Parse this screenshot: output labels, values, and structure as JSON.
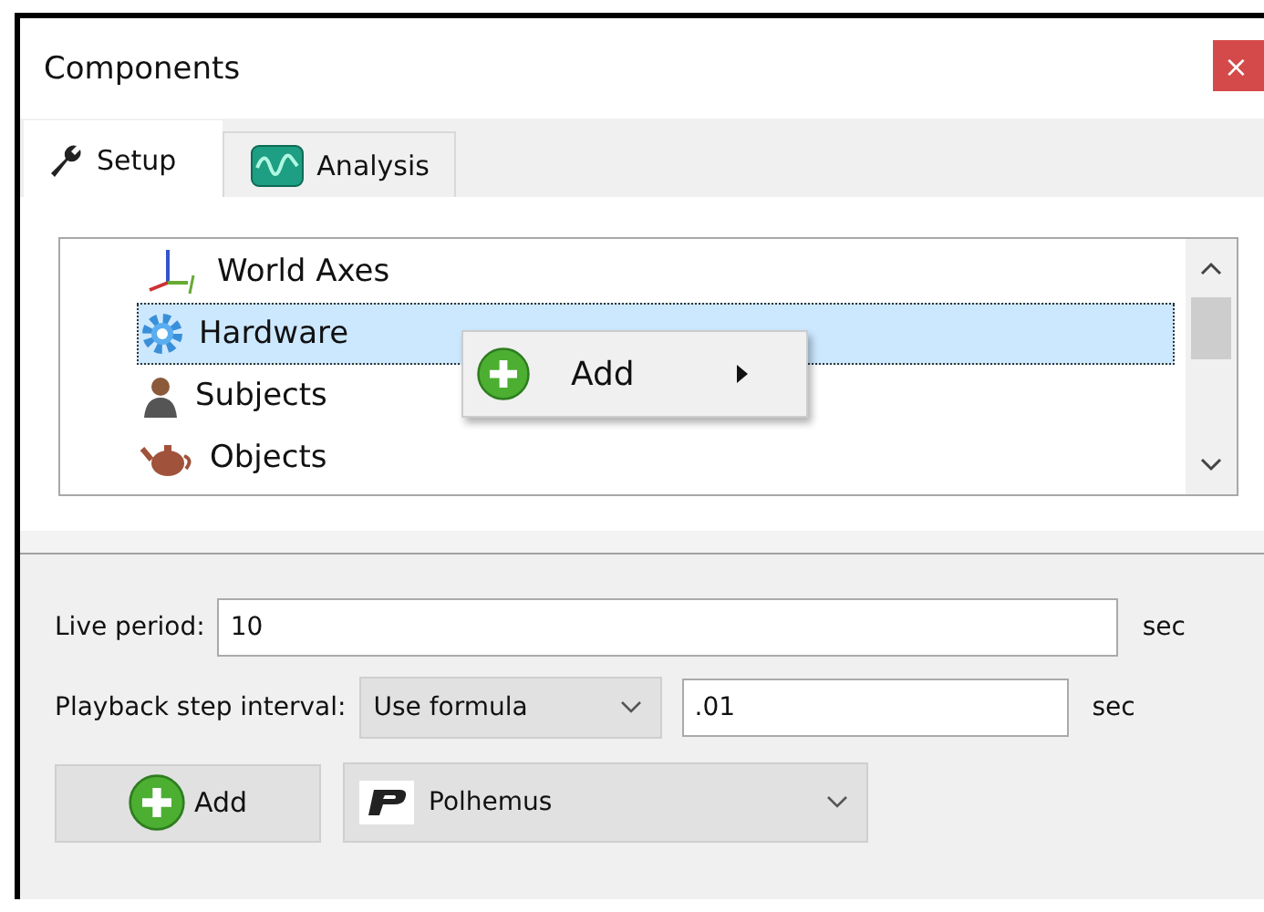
{
  "window": {
    "title": "Components",
    "close": "×"
  },
  "tabs": [
    {
      "label": "Setup",
      "kind": "wrench",
      "selected": true
    },
    {
      "label": "Analysis",
      "kind": "wave",
      "selected": false
    }
  ],
  "tree": {
    "items": [
      {
        "label": "World Axes",
        "kind": "axes",
        "selected": false
      },
      {
        "label": "Hardware",
        "kind": "gear",
        "selected": true
      },
      {
        "label": "Subjects",
        "kind": "person",
        "selected": false
      },
      {
        "label": "Objects",
        "kind": "teapot",
        "selected": false
      }
    ]
  },
  "context_menu": {
    "items": [
      {
        "label": "Add",
        "has_submenu": true
      }
    ]
  },
  "live_period": {
    "label": "Live period:",
    "value": "10",
    "unit": "sec"
  },
  "playback": {
    "label": "Playback step interval:",
    "mode": "Use formula",
    "value": ".01",
    "unit": "sec"
  },
  "add_button": {
    "label": "Add"
  },
  "device": {
    "value": "Polhemus"
  }
}
